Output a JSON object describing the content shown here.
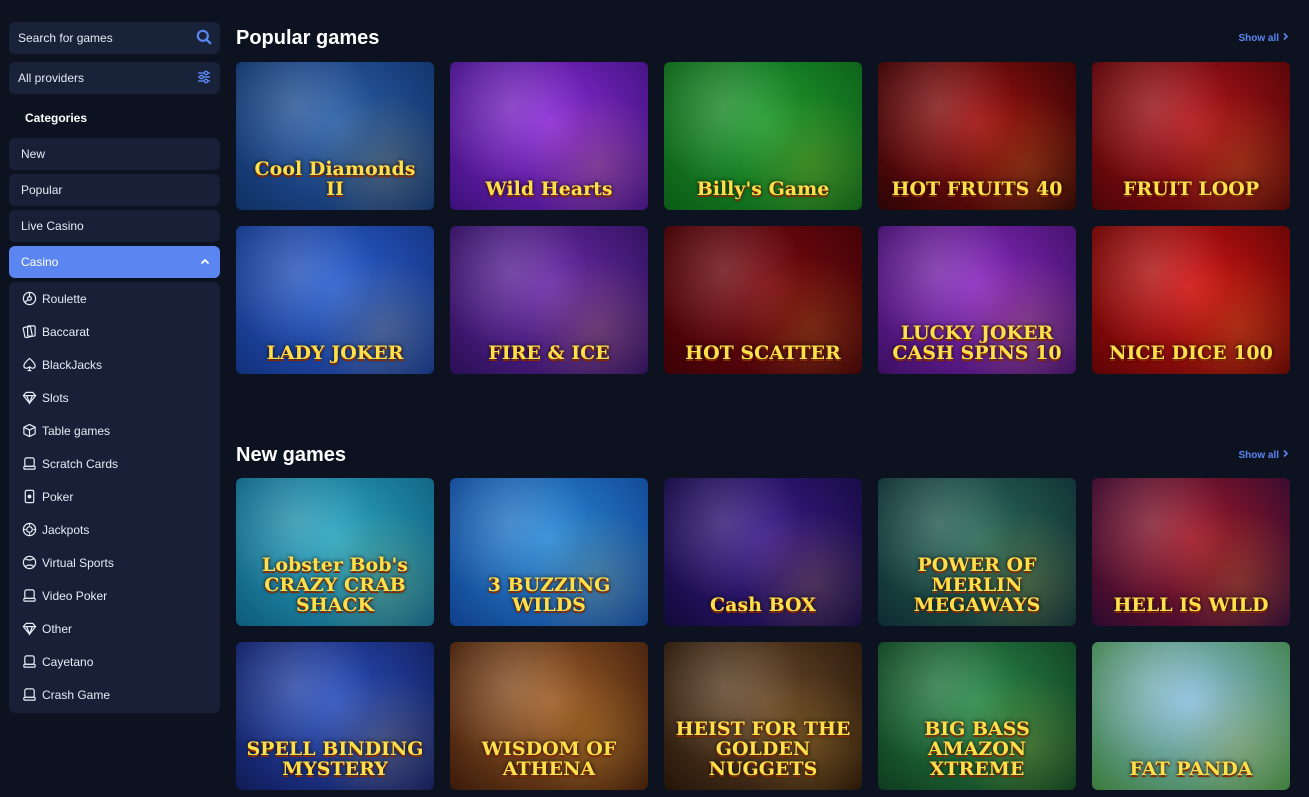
{
  "sidebar": {
    "search_placeholder": "Search for games",
    "providers_label": "All providers",
    "categories_heading": "Categories",
    "categories": [
      {
        "label": "New"
      },
      {
        "label": "Popular"
      },
      {
        "label": "Live Casino"
      },
      {
        "label": "Casino",
        "active": true
      }
    ],
    "sub_items": [
      {
        "label": "Roulette",
        "icon": "roulette-icon"
      },
      {
        "label": "Baccarat",
        "icon": "cards-icon"
      },
      {
        "label": "BlackJacks",
        "icon": "spade-icon"
      },
      {
        "label": "Slots",
        "icon": "diamond-icon"
      },
      {
        "label": "Table games",
        "icon": "dice-icon"
      },
      {
        "label": "Scratch Cards",
        "icon": "scratch-icon"
      },
      {
        "label": "Poker",
        "icon": "card-icon"
      },
      {
        "label": "Jackpots",
        "icon": "chip-icon"
      },
      {
        "label": "Virtual Sports",
        "icon": "ball-icon"
      },
      {
        "label": "Video Poker",
        "icon": "scratch-icon"
      },
      {
        "label": "Other",
        "icon": "diamond-icon"
      },
      {
        "label": "Cayetano",
        "icon": "scratch-icon"
      },
      {
        "label": "Crash Game",
        "icon": "scratch-icon"
      }
    ]
  },
  "popular": {
    "title": "Popular games",
    "show_all": "Show all",
    "games": [
      {
        "name": "Cool Diamonds II",
        "bg": "#2a5fa8",
        "bg2": "#0f2e63"
      },
      {
        "name": "Wild Hearts",
        "bg": "#8a2bd6",
        "bg2": "#3b1078"
      },
      {
        "name": "Billy's Game",
        "bg": "#1f9a2e",
        "bg2": "#0b5a16"
      },
      {
        "name": "HOT FRUITS 40",
        "bg": "#a01010",
        "bg2": "#2a0404"
      },
      {
        "name": "FRUIT LOOP",
        "bg": "#b3141a",
        "bg2": "#4a0406"
      },
      {
        "name": "LADY JOKER",
        "bg": "#2a5fd0",
        "bg2": "#12307a"
      },
      {
        "name": "FIRE & ICE",
        "bg": "#6a2aa8",
        "bg2": "#2a0f55"
      },
      {
        "name": "HOT SCATTER",
        "bg": "#7a0a10",
        "bg2": "#3a0206"
      },
      {
        "name": "LUCKY JOKER CASH SPINS 10",
        "bg": "#8a2ac0",
        "bg2": "#3a0e60"
      },
      {
        "name": "NICE DICE 100",
        "bg": "#d01414",
        "bg2": "#5a0404"
      }
    ]
  },
  "new": {
    "title": "New games",
    "show_all": "Show all",
    "games": [
      {
        "name": "Lobster Bob's CRAZY CRAB SHACK",
        "bg": "#2aa6c0",
        "bg2": "#0e5a7a"
      },
      {
        "name": "3 BUZZING WILDS",
        "bg": "#2a8ad8",
        "bg2": "#0f3e8a"
      },
      {
        "name": "Cash BOX",
        "bg": "#3a1a8a",
        "bg2": "#120a3a"
      },
      {
        "name": "POWER OF MERLIN MEGAWAYS",
        "bg": "#2a6a5a",
        "bg2": "#0e2a30"
      },
      {
        "name": "HELL IS WILD",
        "bg": "#a01828",
        "bg2": "#2a0a30"
      },
      {
        "name": "SPELL BINDING MYSTERY",
        "bg": "#2a50c0",
        "bg2": "#101a55"
      },
      {
        "name": "WISDOM OF ATHENA",
        "bg": "#a0602a",
        "bg2": "#3a1a0a"
      },
      {
        "name": "HEIST FOR THE GOLDEN NUGGETS",
        "bg": "#6a4a2a",
        "bg2": "#241408"
      },
      {
        "name": "BIG BASS AMAZON XTREME",
        "bg": "#2a8a4a",
        "bg2": "#0e3a1e"
      },
      {
        "name": "FAT PANDA",
        "bg": "#8ac0e0",
        "bg2": "#3a7a3a"
      }
    ]
  }
}
